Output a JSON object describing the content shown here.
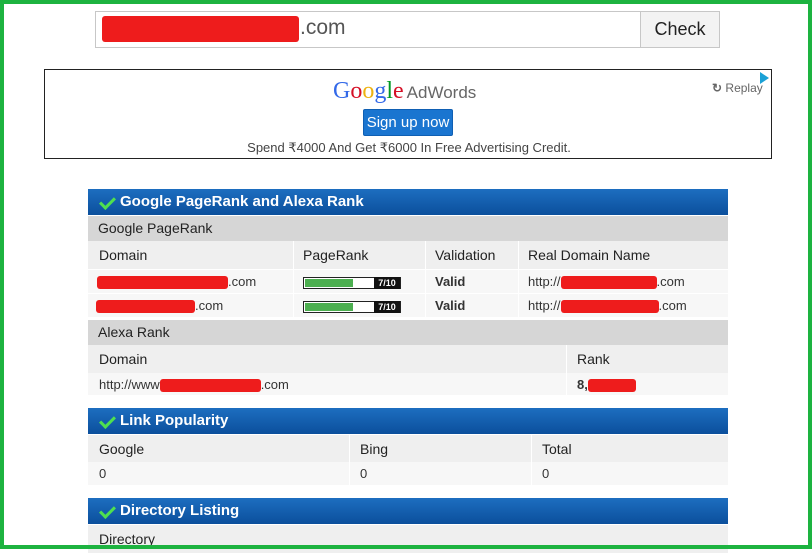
{
  "search": {
    "suffix": ".com",
    "button_label": "Check"
  },
  "ad": {
    "logo_letters": [
      "G",
      "o",
      "o",
      "g",
      "l",
      "e"
    ],
    "logo_product": "AdWords",
    "signup_label": "Sign up now",
    "offer_text": "Spend ₹4000 And Get ₹6000 In Free Advertising Credit.",
    "replay_label": "Replay"
  },
  "pagerank_section": {
    "title": "Google PageRank and Alexa Rank",
    "google_pagerank": {
      "title": "Google PageRank",
      "columns": [
        "Domain",
        "PageRank",
        "Validation",
        "Real Domain Name"
      ],
      "rows": [
        {
          "domain_suffix": ".com",
          "pagerank": 7,
          "pagerank_max": 10,
          "pagerank_label": "7/10",
          "validation": "Valid",
          "real_prefix": "http://",
          "real_suffix": ".com"
        },
        {
          "domain_suffix": ".com",
          "pagerank": 7,
          "pagerank_max": 10,
          "pagerank_label": "7/10",
          "validation": "Valid",
          "real_prefix": "http://",
          "real_suffix": ".com"
        }
      ]
    },
    "alexa_rank": {
      "title": "Alexa Rank",
      "columns": [
        "Domain",
        "Rank"
      ],
      "row": {
        "domain_prefix": "http://www",
        "domain_suffix": ".com",
        "rank_prefix": "8,"
      }
    }
  },
  "link_popularity": {
    "title": "Link Popularity",
    "columns": [
      "Google",
      "Bing",
      "Total"
    ],
    "values": [
      "0",
      "0",
      "0"
    ]
  },
  "directory_listing": {
    "title": "Directory Listing",
    "columns": [
      "Directory"
    ]
  },
  "colors": {
    "frame": "#1db340",
    "header_blue": "#0b4f9c",
    "valid_green": "#118811",
    "redaction": "#ee1c1c"
  }
}
